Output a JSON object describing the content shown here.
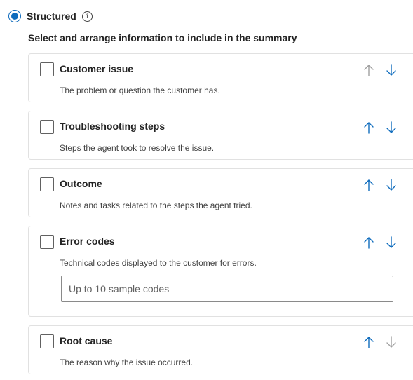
{
  "mode": {
    "label": "Structured",
    "selected": true,
    "info_icon": "info-icon"
  },
  "instructions": "Select and arrange information to include in the summary",
  "colors": {
    "accent": "#0f6cbd",
    "arrow_enabled": "#0f6cbd",
    "arrow_disabled": "#a0a0a0",
    "card_border": "#e1e1e1"
  },
  "items": [
    {
      "title": "Customer issue",
      "description": "The problem or question the customer has.",
      "checked": false,
      "up_enabled": false,
      "down_enabled": true
    },
    {
      "title": "Troubleshooting steps",
      "description": "Steps the agent took to resolve the issue.",
      "checked": false,
      "up_enabled": true,
      "down_enabled": true
    },
    {
      "title": "Outcome",
      "description": "Notes and tasks related to the steps the agent tried.",
      "checked": false,
      "up_enabled": true,
      "down_enabled": true
    },
    {
      "title": "Error codes",
      "description": "Technical codes displayed to the customer for errors.",
      "checked": false,
      "up_enabled": true,
      "down_enabled": true,
      "input": {
        "placeholder": "Up to 10 sample codes",
        "value": ""
      }
    },
    {
      "title": "Root cause",
      "description": "The reason why the issue occurred.",
      "checked": false,
      "up_enabled": true,
      "down_enabled": false
    }
  ]
}
